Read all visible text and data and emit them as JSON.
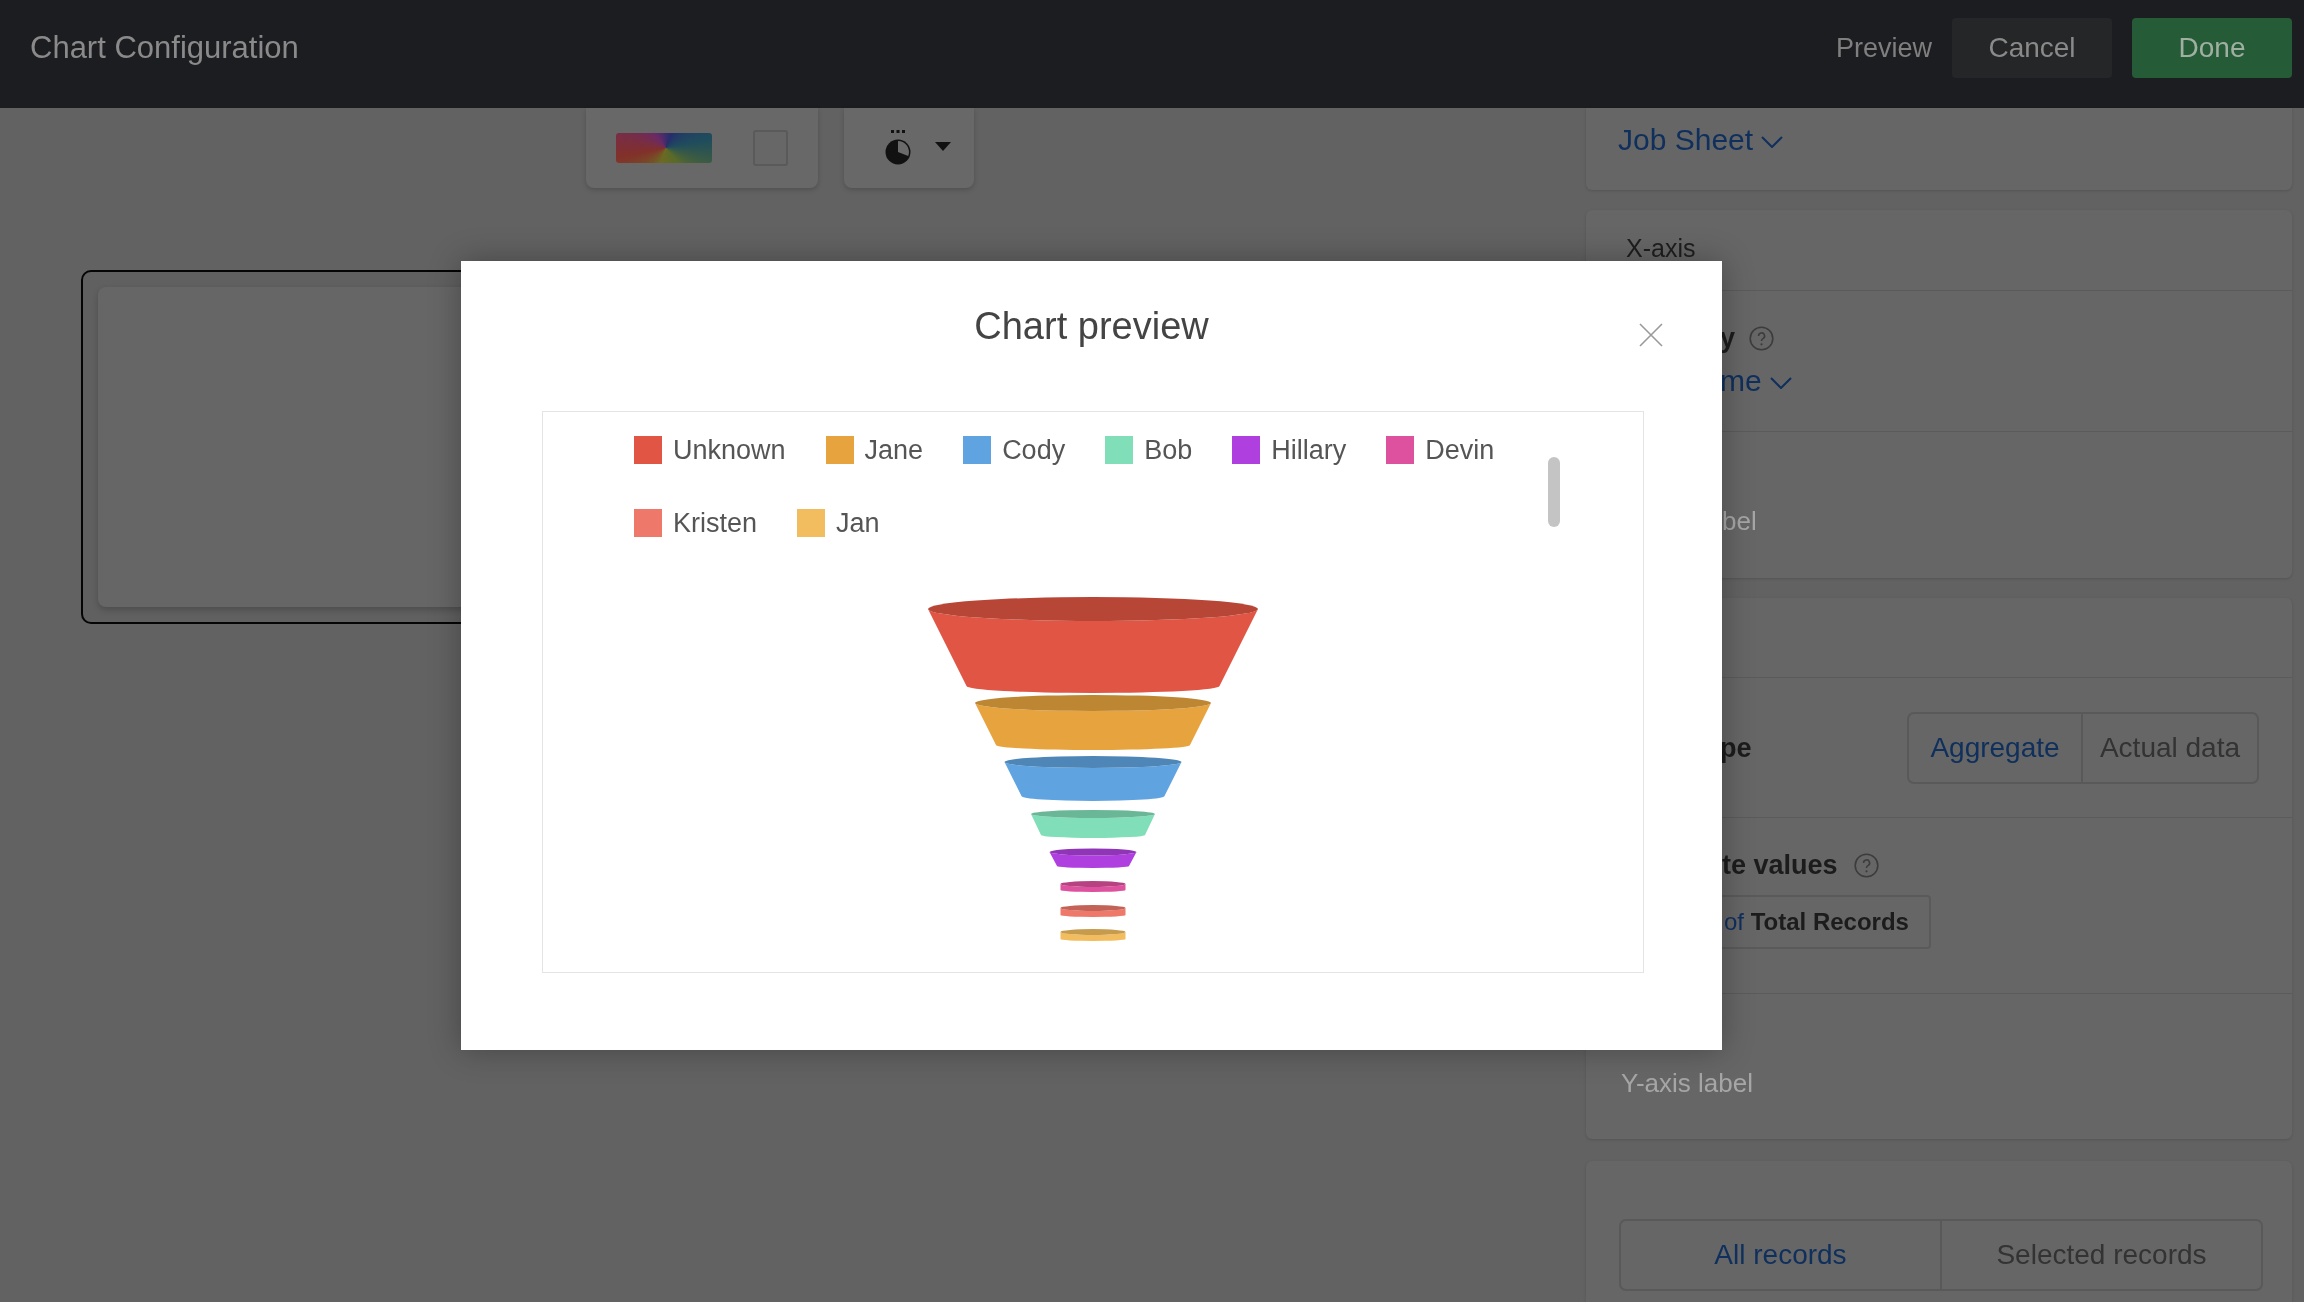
{
  "top_bar": {
    "title": "Chart Configuration",
    "buttons": [
      {
        "label": "Preview",
        "kind": "link"
      },
      {
        "label": "Cancel",
        "kind": "secondary"
      },
      {
        "label": "Done",
        "kind": "primary"
      }
    ]
  },
  "settings_panel": {
    "source": {
      "value": "Job Sheet"
    },
    "x_axis": {
      "title": "X-axis",
      "field_label": "y",
      "field_value": "me",
      "label_placeholder": "bel"
    },
    "y_axis": {
      "type_label": "pe",
      "type_options": [
        {
          "label": "Aggregate",
          "selected": true
        },
        {
          "label": "Actual data",
          "selected": false
        }
      ],
      "aggregate_label": "te values",
      "aggregate_value": "of **Total Records**",
      "label_placeholder": "Y-axis label"
    },
    "records": {
      "options": [
        {
          "label": "All records",
          "selected": true
        },
        {
          "label": "Selected records",
          "selected": false
        }
      ]
    }
  },
  "modal": {
    "title": "Chart preview",
    "legend": [
      {
        "label": "Unknown",
        "color": "#e05543"
      },
      {
        "label": "Jane",
        "color": "#e6a33e"
      },
      {
        "label": "Cody",
        "color": "#5fa3e0"
      },
      {
        "label": "Bob",
        "color": "#80dfb8"
      },
      {
        "label": "Hillary",
        "color": "#b03fe0"
      },
      {
        "label": "Devin",
        "color": "#de519e"
      },
      {
        "label": "Kristen",
        "color": "#ee786a"
      },
      {
        "label": "Jan",
        "color": "#f2bd5e"
      }
    ]
  }
}
